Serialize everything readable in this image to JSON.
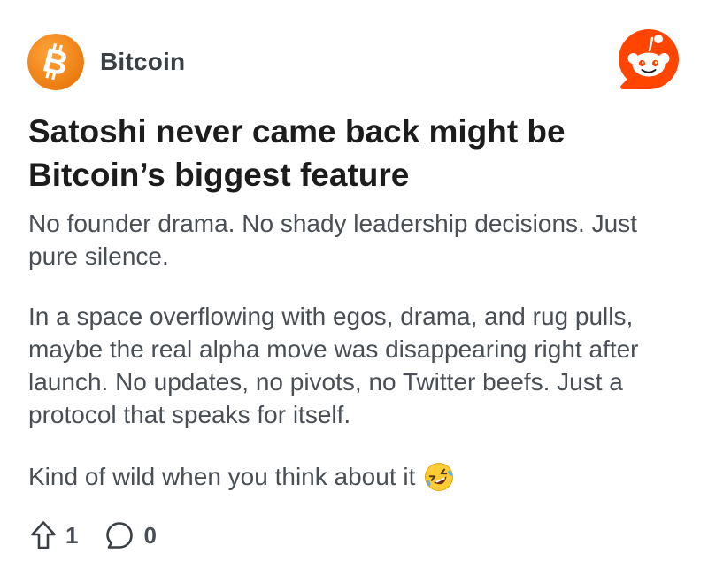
{
  "post": {
    "community": "Bitcoin",
    "title": "Satoshi never came back might be Bitcoin’s biggest feature",
    "paragraphs": [
      "No founder drama. No shady leadership decisions. Just pure silence.",
      "In a space overflowing with egos, drama, and rug pulls, maybe the real alpha move was disappearing right after launch. No updates, no pivots, no Twitter beefs. Just a protocol that speaks for itself.",
      "Kind of wild when you think about it"
    ],
    "emoji": "rolling-on-floor-laughing",
    "upvotes": "1",
    "comments": "0"
  },
  "icons": {
    "community_avatar": "bitcoin-icon",
    "brand": "reddit-logo",
    "upvote": "upvote-arrow-icon",
    "comment": "comment-bubble-icon"
  },
  "colors": {
    "bitcoin_orange": "#f7931a",
    "reddit_orange": "#ff4500",
    "text_primary": "#1c1c1c",
    "text_secondary": "#4a4f55"
  }
}
